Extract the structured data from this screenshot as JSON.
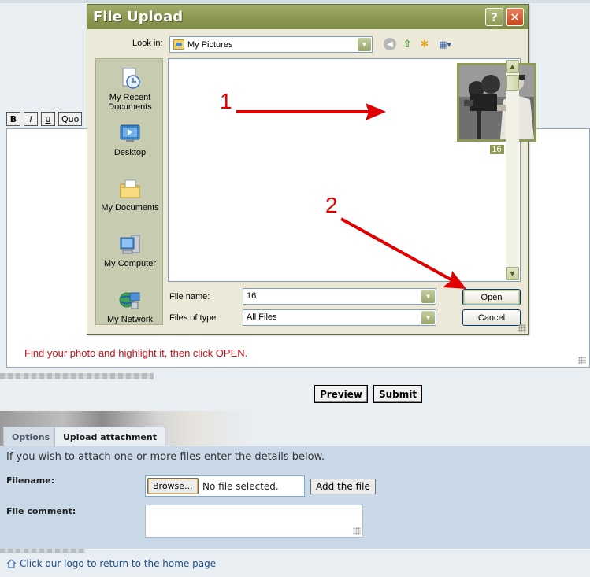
{
  "editor": {
    "format_buttons": [
      "B",
      "i",
      "u",
      "Quo"
    ],
    "instruction": "Find your photo and highlight it, then click OPEN."
  },
  "actions": {
    "preview": "Preview",
    "submit": "Submit"
  },
  "tabs": [
    {
      "label": "Options",
      "active": false
    },
    {
      "label": "Upload attachment",
      "active": true
    }
  ],
  "attach": {
    "intro": "If you wish to attach one or more files enter the details below.",
    "filename_label": "Filename:",
    "browse": "Browse...",
    "no_file": "No file selected.",
    "add_file": "Add the file",
    "comment_label": "File comment:"
  },
  "footer": {
    "link": "Click our logo to return to the home page"
  },
  "dialog": {
    "title": "File Upload",
    "help": "?",
    "close": "✕",
    "look_in_label": "Look in:",
    "look_in_value": "My Pictures",
    "places": [
      {
        "label": "My Recent Documents",
        "icon": "recent-documents-icon"
      },
      {
        "label": "Desktop",
        "icon": "desktop-icon"
      },
      {
        "label": "My Documents",
        "icon": "my-documents-icon"
      },
      {
        "label": "My Computer",
        "icon": "my-computer-icon"
      },
      {
        "label": "My Network",
        "icon": "my-network-icon"
      }
    ],
    "file_item": {
      "label": "16"
    },
    "file_name_label": "File name:",
    "file_name_value": "16",
    "file_type_label": "Files of type:",
    "file_type_value": "All Files",
    "open": "Open",
    "cancel": "Cancel"
  },
  "annotations": {
    "step1": "1",
    "step2": "2",
    "color": "#e00000"
  }
}
